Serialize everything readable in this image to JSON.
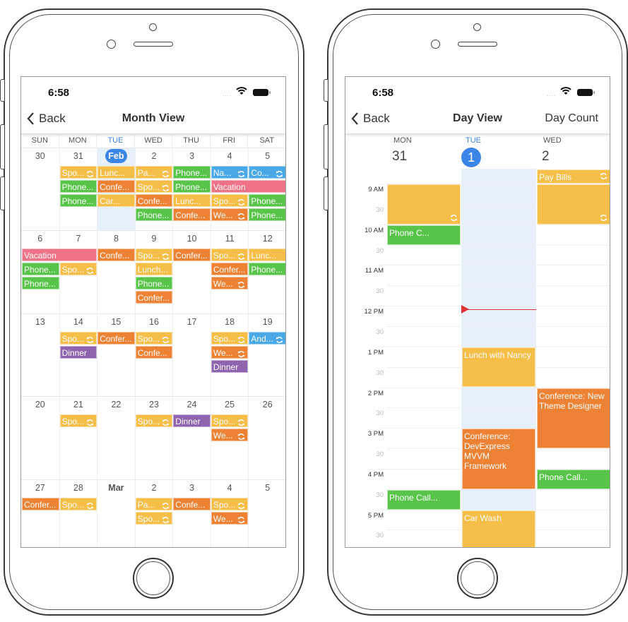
{
  "colors": {
    "yellow": "#F5BE48",
    "orange": "#EE8234",
    "green": "#58C54A",
    "blue": "#4BA8E6",
    "pink": "#EF7386",
    "purple": "#8F63AE",
    "today": "#3A86E8",
    "today_bg": "#E6F0FB",
    "now": "#DD3333"
  },
  "status": {
    "time": "6:58",
    "signal": "....",
    "wifi_icon": "wifi-icon",
    "battery_icon": "battery-icon"
  },
  "month": {
    "nav": {
      "back": "Back",
      "title": "Month View"
    },
    "weekdays": [
      "SUN",
      "MON",
      "TUE",
      "WED",
      "THU",
      "FRI",
      "SAT"
    ],
    "today_index": 2,
    "weeks": [
      [
        {
          "n": "30",
          "ev": []
        },
        {
          "n": "31",
          "ev": [
            {
              "t": "Spo...",
              "c": "yellow",
              "r": true
            },
            {
              "t": "Phone...",
              "c": "green"
            },
            {
              "t": "Phone...",
              "c": "green"
            }
          ]
        },
        {
          "n": "Feb",
          "today": true,
          "ev": [
            {
              "t": "Lunc...",
              "c": "yellow"
            },
            {
              "t": "Confe...",
              "c": "orange"
            },
            {
              "t": "Car...",
              "c": "yellow"
            }
          ]
        },
        {
          "n": "2",
          "ev": [
            {
              "t": "Pa...",
              "c": "yellow",
              "r": true
            },
            {
              "t": "Spo...",
              "c": "yellow",
              "r": true
            },
            {
              "t": "Confe...",
              "c": "orange"
            },
            {
              "t": "Phone...",
              "c": "green"
            }
          ]
        },
        {
          "n": "3",
          "ev": [
            {
              "t": "Phone...",
              "c": "green"
            },
            {
              "t": "Phone...",
              "c": "green"
            },
            {
              "t": "Lunc...",
              "c": "yellow"
            },
            {
              "t": "Confe...",
              "c": "orange"
            }
          ]
        },
        {
          "n": "4",
          "ev": [
            {
              "t": "Na...",
              "c": "blue",
              "r": true
            },
            {
              "t": "Vacation",
              "c": "pink",
              "span": 2
            },
            {
              "t": "Spo...",
              "c": "yellow",
              "r": true
            },
            {
              "t": "We...",
              "c": "orange",
              "r": true
            }
          ]
        },
        {
          "n": "5",
          "ev": [
            {
              "t": "Co...",
              "c": "blue",
              "r": true
            },
            {
              "t": "Phone...",
              "c": "green"
            },
            {
              "t": "Phone...",
              "c": "green"
            }
          ]
        }
      ],
      [
        {
          "n": "6",
          "ev": [
            {
              "t": "Vacation",
              "c": "pink",
              "span": 2
            },
            {
              "t": "Phone...",
              "c": "green"
            },
            {
              "t": "Phone...",
              "c": "green"
            }
          ]
        },
        {
          "n": "7",
          "ev": [
            {
              "t": "Spo...",
              "c": "yellow",
              "r": true
            }
          ]
        },
        {
          "n": "8",
          "ev": [
            {
              "t": "Confe...",
              "c": "orange"
            }
          ]
        },
        {
          "n": "9",
          "ev": [
            {
              "t": "Spo...",
              "c": "yellow",
              "r": true
            },
            {
              "t": "Lunch...",
              "c": "yellow"
            },
            {
              "t": "Phone...",
              "c": "green"
            },
            {
              "t": "Confer...",
              "c": "orange"
            }
          ]
        },
        {
          "n": "10",
          "ev": [
            {
              "t": "Confer...",
              "c": "orange"
            }
          ]
        },
        {
          "n": "11",
          "ev": [
            {
              "t": "Spo...",
              "c": "yellow",
              "r": true
            },
            {
              "t": "Confer...",
              "c": "orange"
            },
            {
              "t": "We...",
              "c": "orange",
              "r": true
            }
          ]
        },
        {
          "n": "12",
          "ev": [
            {
              "t": "Lunc...",
              "c": "yellow"
            },
            {
              "t": "Phone...",
              "c": "green"
            }
          ]
        }
      ],
      [
        {
          "n": "13",
          "ev": []
        },
        {
          "n": "14",
          "ev": [
            {
              "t": "Spo...",
              "c": "yellow",
              "r": true
            },
            {
              "t": "Dinner",
              "c": "purple"
            }
          ]
        },
        {
          "n": "15",
          "ev": [
            {
              "t": "Confer...",
              "c": "orange"
            }
          ]
        },
        {
          "n": "16",
          "ev": [
            {
              "t": "Spo...",
              "c": "yellow",
              "r": true
            },
            {
              "t": "Confe...",
              "c": "orange"
            }
          ]
        },
        {
          "n": "17",
          "ev": []
        },
        {
          "n": "18",
          "ev": [
            {
              "t": "Spo...",
              "c": "yellow",
              "r": true
            },
            {
              "t": "We...",
              "c": "orange",
              "r": true
            },
            {
              "t": "Dinner",
              "c": "purple"
            }
          ]
        },
        {
          "n": "19",
          "ev": [
            {
              "t": "And...",
              "c": "blue",
              "r": true
            }
          ]
        }
      ],
      [
        {
          "n": "20",
          "ev": []
        },
        {
          "n": "21",
          "ev": [
            {
              "t": "Spo...",
              "c": "yellow",
              "r": true
            }
          ]
        },
        {
          "n": "22",
          "ev": []
        },
        {
          "n": "23",
          "ev": [
            {
              "t": "Spo...",
              "c": "yellow",
              "r": true
            }
          ]
        },
        {
          "n": "24",
          "ev": [
            {
              "t": "Dinner",
              "c": "purple"
            }
          ]
        },
        {
          "n": "25",
          "ev": [
            {
              "t": "Spo...",
              "c": "yellow",
              "r": true
            },
            {
              "t": "We...",
              "c": "orange",
              "r": true
            }
          ]
        },
        {
          "n": "26",
          "ev": []
        }
      ],
      [
        {
          "n": "27",
          "ev": [
            {
              "t": "Confer...",
              "c": "orange"
            }
          ]
        },
        {
          "n": "28",
          "ev": [
            {
              "t": "Spo...",
              "c": "yellow",
              "r": true
            }
          ]
        },
        {
          "n": "Mar",
          "bold": true,
          "ev": []
        },
        {
          "n": "2",
          "ev": [
            {
              "t": "Pa...",
              "c": "yellow",
              "r": true
            },
            {
              "t": "Spo...",
              "c": "yellow",
              "r": true
            }
          ]
        },
        {
          "n": "3",
          "ev": [
            {
              "t": "Confe...",
              "c": "orange"
            }
          ]
        },
        {
          "n": "4",
          "ev": [
            {
              "t": "Spo...",
              "c": "yellow",
              "r": true
            },
            {
              "t": "We...",
              "c": "orange",
              "r": true
            }
          ]
        },
        {
          "n": "5",
          "ev": []
        }
      ]
    ]
  },
  "day": {
    "nav": {
      "back": "Back",
      "title": "Day View",
      "right": "Day Count"
    },
    "visible_from": "8:38",
    "current_time": "12:05",
    "hour_labels": [
      {
        "h": 9,
        "t": "9 AM"
      },
      {
        "h": 10,
        "t": "10 AM"
      },
      {
        "h": 11,
        "t": "11 AM"
      },
      {
        "h": 12,
        "t": "12 PM"
      },
      {
        "h": 13,
        "t": "1 PM"
      },
      {
        "h": 14,
        "t": "2 PM"
      },
      {
        "h": 15,
        "t": "3 PM"
      },
      {
        "h": 16,
        "t": "4 PM"
      },
      {
        "h": 17,
        "t": "5 PM"
      }
    ],
    "half_label": "30",
    "days": [
      {
        "wd": "MON",
        "dn": "31",
        "ev": [
          {
            "t": "",
            "c": "yellow",
            "s": 9,
            "e": 10,
            "r": true
          },
          {
            "t": "Phone C...",
            "c": "green",
            "s": 10,
            "e": 10.5
          },
          {
            "t": "Phone Call...",
            "c": "green",
            "s": 16.5,
            "e": 17
          }
        ]
      },
      {
        "wd": "TUE",
        "dn": "1",
        "today": true,
        "ev": [
          {
            "t": "Lunch with Nancy",
            "c": "yellow",
            "s": 13,
            "e": 14
          },
          {
            "t": "Conference: DevExpress MVVM Framework",
            "c": "orange",
            "s": 15,
            "e": 16.5
          },
          {
            "t": "Car Wash",
            "c": "yellow",
            "s": 17,
            "e": 18
          }
        ]
      },
      {
        "wd": "WED",
        "dn": "2",
        "ev": [
          {
            "t": "Pay Bills",
            "c": "yellow",
            "s": 8.5,
            "e": 9,
            "r": true
          },
          {
            "t": "",
            "c": "yellow",
            "s": 9,
            "e": 10,
            "r": true
          },
          {
            "t": "Conference: New Theme Designer",
            "c": "orange",
            "s": 14,
            "e": 15.5
          },
          {
            "t": "Phone Call...",
            "c": "green",
            "s": 16,
            "e": 16.5
          }
        ]
      }
    ]
  }
}
